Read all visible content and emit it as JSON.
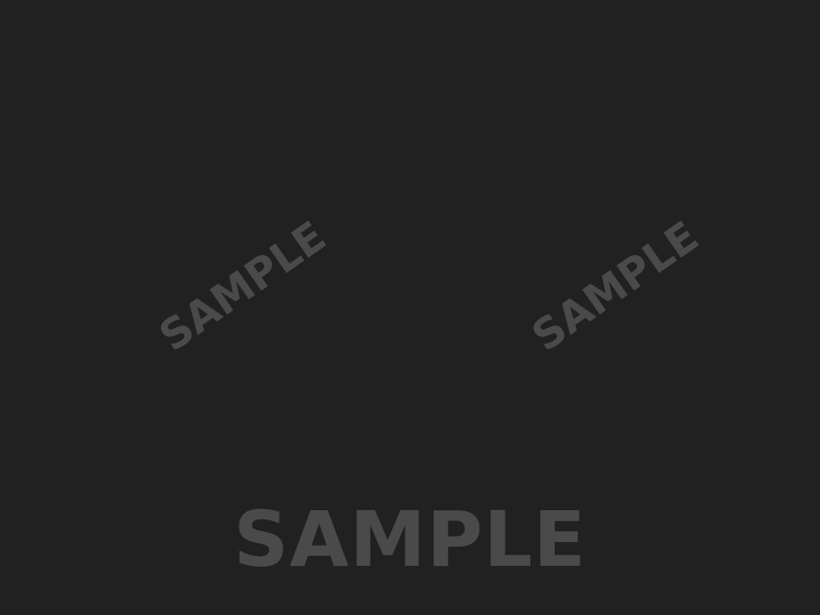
{
  "background_color": "#212121",
  "watermark_color": "#4a4a4a",
  "watermarks": {
    "left_diagonal": "SAMPLE",
    "right_diagonal": "SAMPLE",
    "bottom": "SAMPLE"
  }
}
